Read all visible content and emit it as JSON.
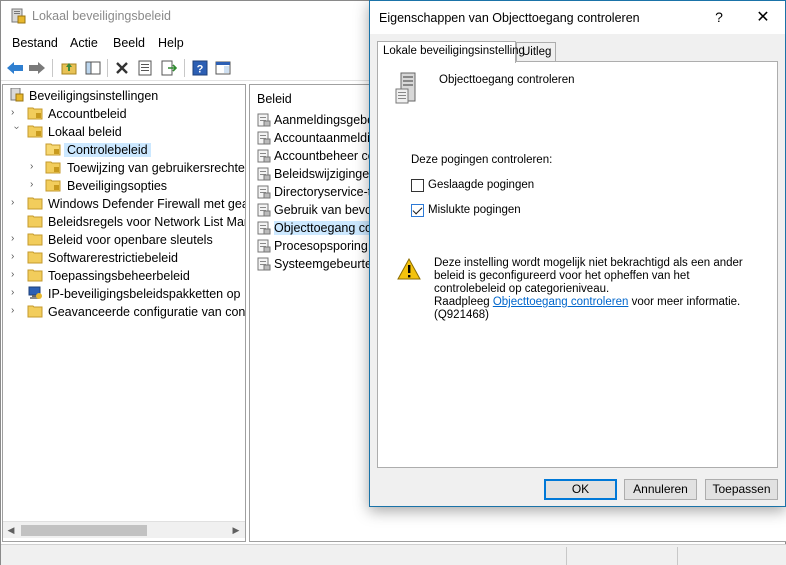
{
  "main_window": {
    "title": "Lokaal beveiligingsbeleid"
  },
  "menu": [
    "Bestand",
    "Actie",
    "Beeld",
    "Help"
  ],
  "toolbar": {
    "buttons": [
      "back-icon",
      "forward-icon",
      "up-folder-icon",
      "show-hide-tree-icon",
      "delete-icon",
      "properties-icon",
      "export-icon",
      "help-icon",
      "console-icon"
    ]
  },
  "tree": {
    "root": "Beveiligingsinstellingen",
    "items": [
      {
        "label": "Accountbeleid",
        "level": 1,
        "expanded": false
      },
      {
        "label": "Lokaal beleid",
        "level": 1,
        "expanded": true
      },
      {
        "label": "Controlebeleid",
        "level": 2,
        "selected": true
      },
      {
        "label": "Toewijzing van gebruikersrechten",
        "level": 2,
        "expanded": false
      },
      {
        "label": "Beveiligingsopties",
        "level": 2,
        "expanded": false
      },
      {
        "label": "Windows Defender Firewall met geava",
        "level": 1,
        "expanded": false
      },
      {
        "label": "Beleidsregels voor Network List Mana",
        "level": 1,
        "expanded": false
      },
      {
        "label": "Beleid voor openbare sleutels",
        "level": 1,
        "expanded": false
      },
      {
        "label": "Softwarerestrictiebeleid",
        "level": 1,
        "expanded": false
      },
      {
        "label": "Toepassingsbeheerbeleid",
        "level": 1,
        "expanded": false
      },
      {
        "label": "IP-beveiligingsbeleidspakketten op Lo",
        "level": 1,
        "expanded": false
      },
      {
        "label": "Geavanceerde configuratie van contro",
        "level": 1,
        "expanded": false
      }
    ]
  },
  "list": {
    "header": "Beleid",
    "items": [
      {
        "label": "Aanmeldingsgebeurtenissen controleren"
      },
      {
        "label": "Accountaanmeldingsgebeurtenissen controleren"
      },
      {
        "label": "Accountbeheer controleren"
      },
      {
        "label": "Beleidswijzigingen controleren"
      },
      {
        "label": "Directoryservice-toegang controleren"
      },
      {
        "label": "Gebruik van bevoegdheden controleren"
      },
      {
        "label": "Objecttoegang controleren",
        "selected": true
      },
      {
        "label": "Procesopsporing controleren"
      },
      {
        "label": "Systeemgebeurtenissen controleren"
      }
    ]
  },
  "dialog": {
    "title": "Eigenschappen van Objecttoegang controleren",
    "help": "?",
    "close": "✕",
    "tabs": [
      "Lokale beveiligingsinstelling",
      "Uitleg"
    ],
    "policy_name": "Objecttoegang controleren",
    "section_label": "Deze pogingen controleren:",
    "checkboxes": [
      {
        "label": "Geslaagde pogingen",
        "checked": false
      },
      {
        "label": "Mislukte pogingen",
        "checked": true
      }
    ],
    "warning": {
      "line1": "Deze instelling wordt mogelijk niet bekrachtigd als een ander beleid is geconfigureerd voor het opheffen van het controlebeleid op categorieniveau.",
      "prefix": "Raadpleeg ",
      "link": "Objecttoegang controleren",
      "suffix": " voor meer informatie.",
      "code": "(Q921468)"
    },
    "buttons": {
      "ok": "OK",
      "cancel": "Annuleren",
      "apply": "Toepassen"
    }
  },
  "colors": {
    "accent": "#0078d7",
    "selection": "#cce8ff",
    "link": "#0066cc"
  }
}
